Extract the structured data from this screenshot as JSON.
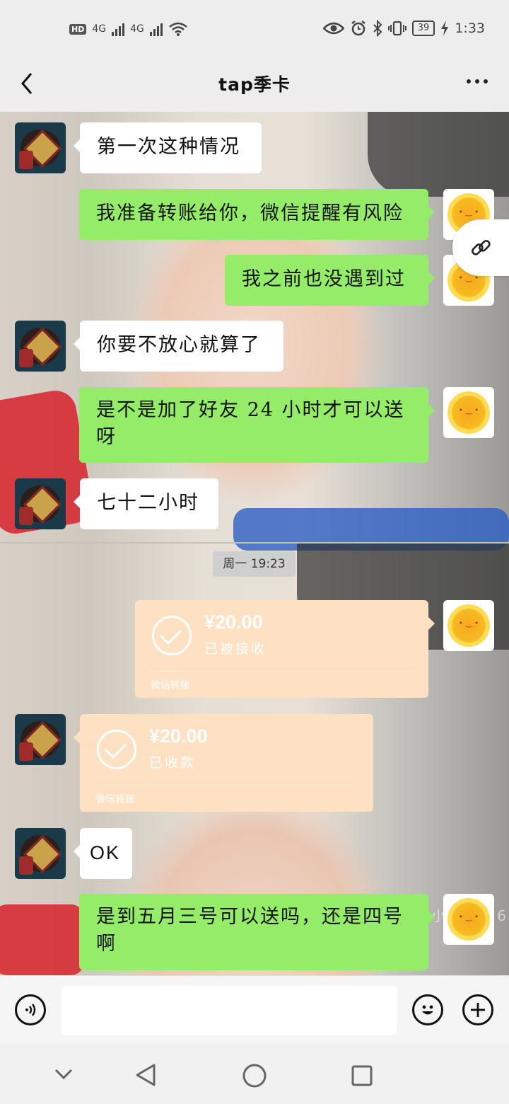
{
  "status_bar": {
    "network_badge": "HD",
    "sim1": "4G",
    "sim2": "4G",
    "battery": "39",
    "time": "1:33"
  },
  "header": {
    "title": "tap季卡"
  },
  "messages": [
    {
      "side": "left",
      "text": "第一次这种情况"
    },
    {
      "side": "right",
      "text": "我准备转账给你，微信提醒有风险"
    },
    {
      "side": "right",
      "text": "我之前也没遇到过"
    },
    {
      "side": "left",
      "text": "你要不放心就算了"
    },
    {
      "side": "right",
      "text": "是不是加了好友 24 小时才可以送呀"
    },
    {
      "side": "left",
      "text": "七十二小时"
    },
    {
      "side": "left",
      "text": "OK"
    },
    {
      "side": "right",
      "text": "是到五月三号可以送吗，还是四号啊"
    }
  ],
  "time_divider": "周一 19:23",
  "transfers": [
    {
      "side": "right",
      "amount": "¥20.00",
      "status": "已被接收",
      "footer": "微信转账"
    },
    {
      "side": "left",
      "amount": "¥20.00",
      "status": "已收款",
      "footer": "微信转账"
    }
  ],
  "watermark": "小红书号: 6",
  "input": {
    "value": "",
    "placeholder": ""
  },
  "colors": {
    "outgoing_bubble": "#95ec69",
    "incoming_bubble": "#ffffff",
    "transfer_card": "#fde1c2"
  },
  "icons": [
    "back-icon",
    "more-icon",
    "link-icon",
    "voice-icon",
    "emoji-icon",
    "plus-icon",
    "nav-back-icon",
    "nav-home-icon",
    "nav-recents-icon",
    "nav-collapse-icon"
  ]
}
